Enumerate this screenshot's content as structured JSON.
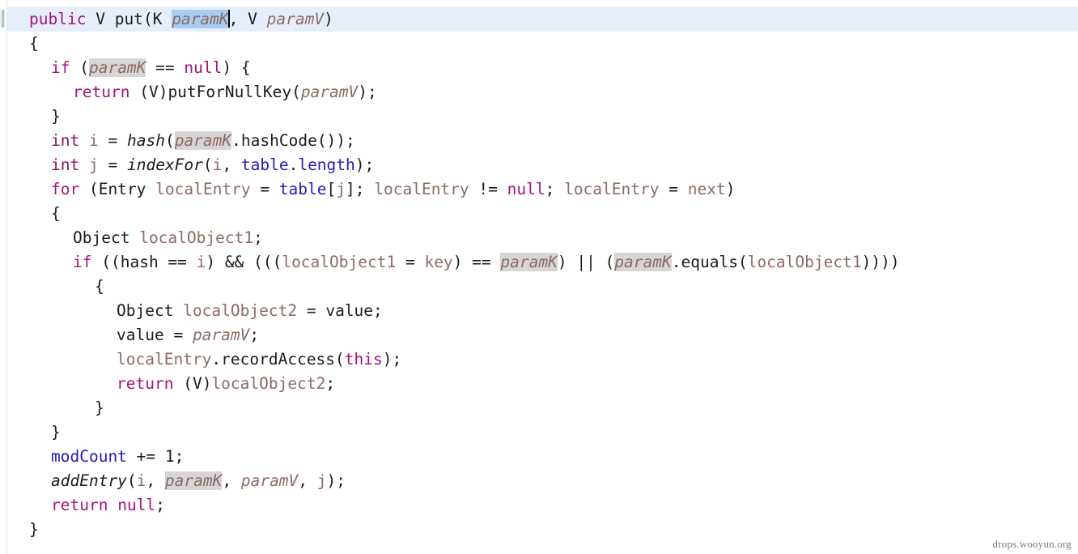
{
  "editor": {
    "language": "java",
    "watermark": "drops.wooyun.org",
    "current_line_index": 0,
    "caret_after": "paramK",
    "selection_text": "paramK",
    "occurrence_highlight_token": "paramK",
    "colors": {
      "background": "#ffffff",
      "current_line": "#e6eff9",
      "selection": "#a8cdf0",
      "occurrence_highlight": "#d6d6d6",
      "keyword": "#a5127e",
      "primitive_type": "#8b1060",
      "identifier": "#1b1b1b",
      "local_variable": "#8d6a66",
      "field": "#2020b0",
      "caret": "#000000",
      "gutter_rule": "#e6e6e6",
      "watermark": "#7b7b7b"
    }
  },
  "code": {
    "lines": [
      {
        "indent": 0,
        "tokens": [
          {
            "t": "public",
            "c": "kw"
          },
          {
            "t": " ",
            "c": "plain"
          },
          {
            "t": "V",
            "c": "plain"
          },
          {
            "t": " ",
            "c": "plain"
          },
          {
            "t": "put",
            "c": "plain"
          },
          {
            "t": "(",
            "c": "plain"
          },
          {
            "t": "K",
            "c": "plain"
          },
          {
            "t": " ",
            "c": "plain"
          },
          {
            "t": "paramK",
            "c": "var ital sel"
          },
          {
            "t": "CARET",
            "c": "caret"
          },
          {
            "t": ", ",
            "c": "plain"
          },
          {
            "t": "V",
            "c": "plain"
          },
          {
            "t": " ",
            "c": "plain"
          },
          {
            "t": "paramV",
            "c": "var ital"
          },
          {
            "t": ")",
            "c": "plain"
          }
        ]
      },
      {
        "indent": 0,
        "tokens": [
          {
            "t": "{",
            "c": "plain"
          }
        ]
      },
      {
        "indent": 1,
        "tokens": [
          {
            "t": "if",
            "c": "kw"
          },
          {
            "t": " (",
            "c": "plain"
          },
          {
            "t": "paramK",
            "c": "var ital hl"
          },
          {
            "t": " == ",
            "c": "plain"
          },
          {
            "t": "null",
            "c": "kw"
          },
          {
            "t": ") {",
            "c": "plain"
          }
        ]
      },
      {
        "indent": 2,
        "tokens": [
          {
            "t": "return",
            "c": "kw"
          },
          {
            "t": " (",
            "c": "plain"
          },
          {
            "t": "V",
            "c": "plain"
          },
          {
            "t": ")",
            "c": "plain"
          },
          {
            "t": "putForNullKey",
            "c": "plain"
          },
          {
            "t": "(",
            "c": "plain"
          },
          {
            "t": "paramV",
            "c": "var ital"
          },
          {
            "t": ");",
            "c": "plain"
          }
        ]
      },
      {
        "indent": 1,
        "tokens": [
          {
            "t": "}",
            "c": "plain"
          }
        ]
      },
      {
        "indent": 1,
        "tokens": [
          {
            "t": "int",
            "c": "kw2"
          },
          {
            "t": " ",
            "c": "plain"
          },
          {
            "t": "i",
            "c": "var"
          },
          {
            "t": " = ",
            "c": "plain"
          },
          {
            "t": "hash",
            "c": "plain ital"
          },
          {
            "t": "(",
            "c": "plain"
          },
          {
            "t": "paramK",
            "c": "var ital hl"
          },
          {
            "t": ".",
            "c": "plain"
          },
          {
            "t": "hashCode",
            "c": "plain"
          },
          {
            "t": "());",
            "c": "plain"
          }
        ]
      },
      {
        "indent": 1,
        "tokens": [
          {
            "t": "int",
            "c": "kw2"
          },
          {
            "t": " ",
            "c": "plain"
          },
          {
            "t": "j",
            "c": "var"
          },
          {
            "t": " = ",
            "c": "plain"
          },
          {
            "t": "indexFor",
            "c": "plain ital"
          },
          {
            "t": "(",
            "c": "plain"
          },
          {
            "t": "i",
            "c": "var"
          },
          {
            "t": ", ",
            "c": "plain"
          },
          {
            "t": "table",
            "c": "field"
          },
          {
            "t": ".",
            "c": "plain"
          },
          {
            "t": "length",
            "c": "field"
          },
          {
            "t": ");",
            "c": "plain"
          }
        ]
      },
      {
        "indent": 1,
        "tokens": [
          {
            "t": "for",
            "c": "kw"
          },
          {
            "t": " (",
            "c": "plain"
          },
          {
            "t": "Entry",
            "c": "plain"
          },
          {
            "t": " ",
            "c": "plain"
          },
          {
            "t": "localEntry",
            "c": "var"
          },
          {
            "t": " = ",
            "c": "plain"
          },
          {
            "t": "table",
            "c": "field"
          },
          {
            "t": "[",
            "c": "plain"
          },
          {
            "t": "j",
            "c": "var"
          },
          {
            "t": "]; ",
            "c": "plain"
          },
          {
            "t": "localEntry",
            "c": "var"
          },
          {
            "t": " != ",
            "c": "plain"
          },
          {
            "t": "null",
            "c": "kw"
          },
          {
            "t": "; ",
            "c": "plain"
          },
          {
            "t": "localEntry",
            "c": "var"
          },
          {
            "t": " = ",
            "c": "plain"
          },
          {
            "t": "next",
            "c": "var"
          },
          {
            "t": ")",
            "c": "plain"
          }
        ]
      },
      {
        "indent": 1,
        "tokens": [
          {
            "t": "{",
            "c": "plain"
          }
        ]
      },
      {
        "indent": 2,
        "tokens": [
          {
            "t": "Object",
            "c": "plain"
          },
          {
            "t": " ",
            "c": "plain"
          },
          {
            "t": "localObject1",
            "c": "var"
          },
          {
            "t": ";",
            "c": "plain"
          }
        ]
      },
      {
        "indent": 2,
        "tokens": [
          {
            "t": "if",
            "c": "kw"
          },
          {
            "t": " ((",
            "c": "plain"
          },
          {
            "t": "hash",
            "c": "plain"
          },
          {
            "t": " == ",
            "c": "plain"
          },
          {
            "t": "i",
            "c": "var"
          },
          {
            "t": ") && (((",
            "c": "plain"
          },
          {
            "t": "localObject1",
            "c": "var"
          },
          {
            "t": " = ",
            "c": "plain"
          },
          {
            "t": "key",
            "c": "var"
          },
          {
            "t": ") == ",
            "c": "plain"
          },
          {
            "t": "paramK",
            "c": "var ital hl"
          },
          {
            "t": ") || (",
            "c": "plain"
          },
          {
            "t": "paramK",
            "c": "var ital hl"
          },
          {
            "t": ".",
            "c": "plain"
          },
          {
            "t": "equals",
            "c": "plain"
          },
          {
            "t": "(",
            "c": "plain"
          },
          {
            "t": "localObject1",
            "c": "var"
          },
          {
            "t": "))))",
            "c": "plain"
          }
        ]
      },
      {
        "indent": 3,
        "tokens": [
          {
            "t": "{",
            "c": "plain"
          }
        ]
      },
      {
        "indent": 4,
        "tokens": [
          {
            "t": "Object",
            "c": "plain"
          },
          {
            "t": " ",
            "c": "plain"
          },
          {
            "t": "localObject2",
            "c": "var"
          },
          {
            "t": " = ",
            "c": "plain"
          },
          {
            "t": "value",
            "c": "plain"
          },
          {
            "t": ";",
            "c": "plain"
          }
        ]
      },
      {
        "indent": 4,
        "tokens": [
          {
            "t": "value",
            "c": "plain"
          },
          {
            "t": " = ",
            "c": "plain"
          },
          {
            "t": "paramV",
            "c": "var ital"
          },
          {
            "t": ";",
            "c": "plain"
          }
        ]
      },
      {
        "indent": 4,
        "tokens": [
          {
            "t": "localEntry",
            "c": "var"
          },
          {
            "t": ".",
            "c": "plain"
          },
          {
            "t": "recordAccess",
            "c": "plain"
          },
          {
            "t": "(",
            "c": "plain"
          },
          {
            "t": "this",
            "c": "kw"
          },
          {
            "t": ");",
            "c": "plain"
          }
        ]
      },
      {
        "indent": 4,
        "tokens": [
          {
            "t": "return",
            "c": "kw"
          },
          {
            "t": " (",
            "c": "plain"
          },
          {
            "t": "V",
            "c": "plain"
          },
          {
            "t": ")",
            "c": "plain"
          },
          {
            "t": "localObject2",
            "c": "var"
          },
          {
            "t": ";",
            "c": "plain"
          }
        ]
      },
      {
        "indent": 3,
        "tokens": [
          {
            "t": "}",
            "c": "plain"
          }
        ]
      },
      {
        "indent": 1,
        "tokens": [
          {
            "t": "}",
            "c": "plain"
          }
        ]
      },
      {
        "indent": 1,
        "tokens": [
          {
            "t": "modCount",
            "c": "field"
          },
          {
            "t": " += ",
            "c": "plain"
          },
          {
            "t": "1",
            "c": "plain"
          },
          {
            "t": ";",
            "c": "plain"
          }
        ]
      },
      {
        "indent": 1,
        "tokens": [
          {
            "t": "addEntry",
            "c": "plain ital"
          },
          {
            "t": "(",
            "c": "plain"
          },
          {
            "t": "i",
            "c": "var"
          },
          {
            "t": ", ",
            "c": "plain"
          },
          {
            "t": "paramK",
            "c": "var ital hl"
          },
          {
            "t": ", ",
            "c": "plain"
          },
          {
            "t": "paramV",
            "c": "var ital"
          },
          {
            "t": ", ",
            "c": "plain"
          },
          {
            "t": "j",
            "c": "var"
          },
          {
            "t": ");",
            "c": "plain"
          }
        ]
      },
      {
        "indent": 1,
        "tokens": [
          {
            "t": "return",
            "c": "kw"
          },
          {
            "t": " ",
            "c": "plain"
          },
          {
            "t": "null",
            "c": "kw"
          },
          {
            "t": ";",
            "c": "plain"
          }
        ]
      },
      {
        "indent": 0,
        "tokens": [
          {
            "t": "}",
            "c": "plain"
          }
        ]
      }
    ]
  }
}
